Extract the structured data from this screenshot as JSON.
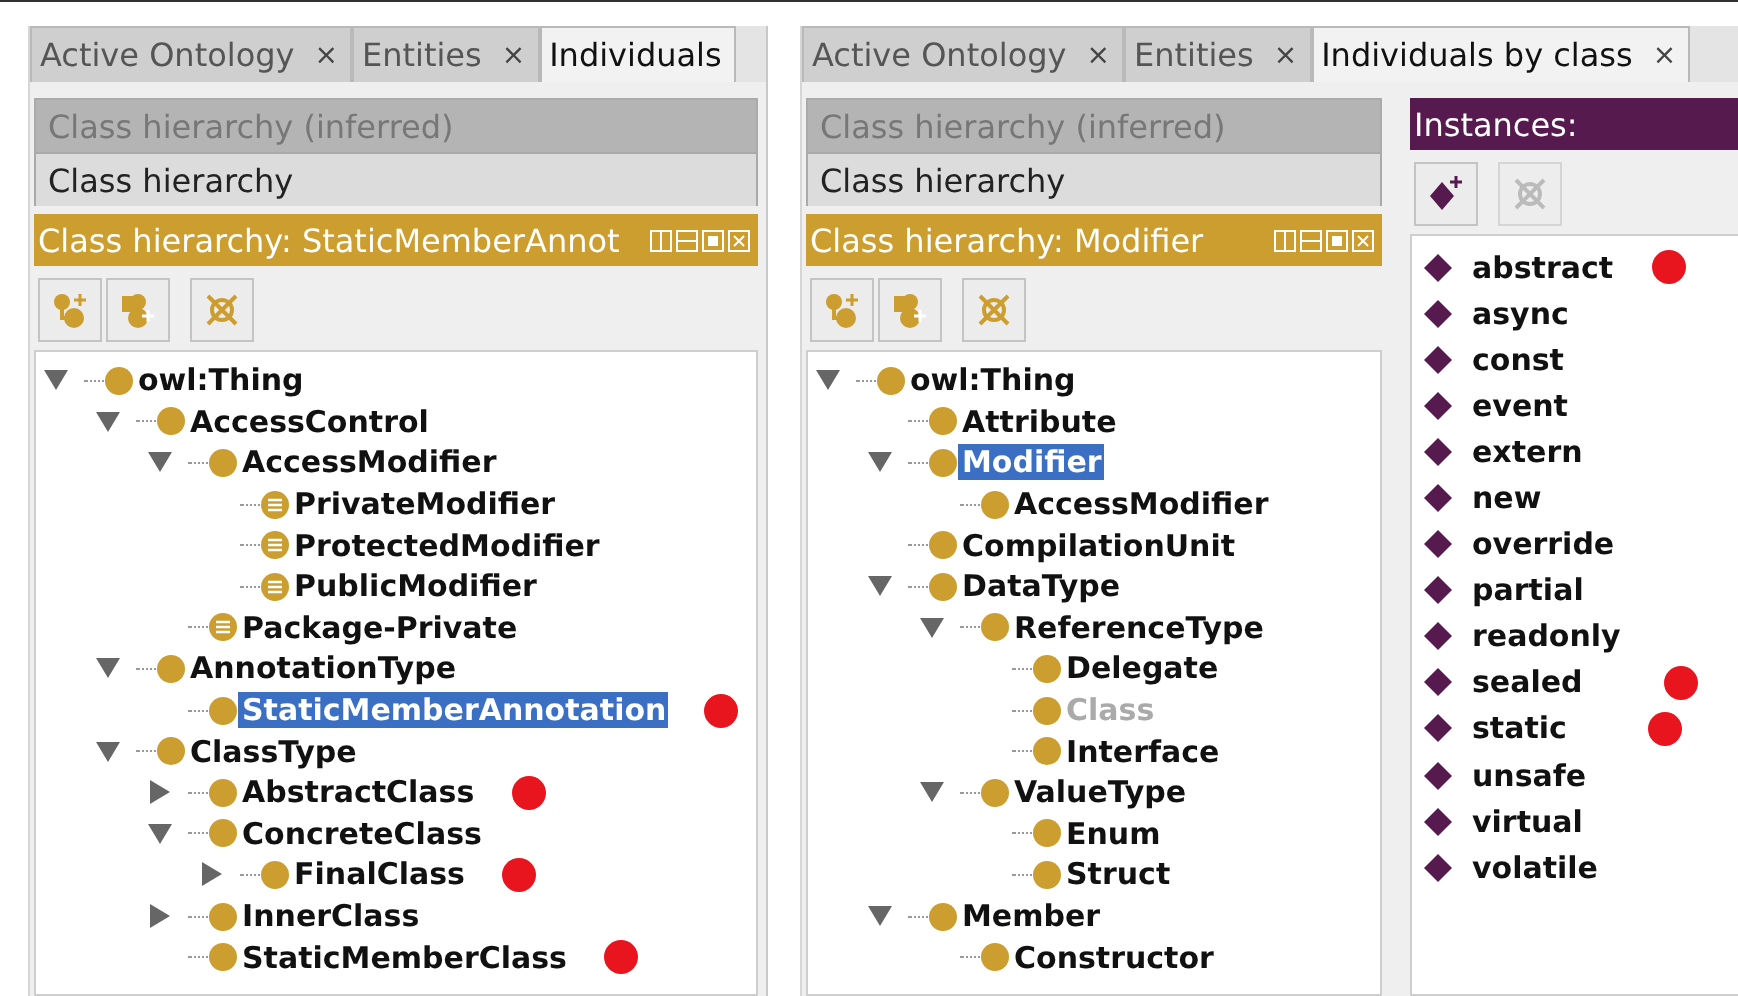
{
  "windows": [
    {
      "tabs": [
        {
          "label": "Active Ontology",
          "close": "×",
          "selected": false
        },
        {
          "label": "Entities",
          "close": "×",
          "selected": false
        },
        {
          "label": "Individuals",
          "selected": true
        }
      ],
      "views": [
        {
          "label": "Class hierarchy (inferred)",
          "selected": false
        },
        {
          "label": "Class hierarchy",
          "selected": true
        }
      ],
      "hierarchy_title": "Class hierarchy: StaticMemberAnnot",
      "tree": [
        {
          "label": "owl:Thing",
          "kind": "class",
          "expanded": true,
          "selected": false,
          "children": [
            {
              "label": "AccessControl",
              "kind": "class",
              "expanded": true,
              "selected": false,
              "children": [
                {
                  "label": "AccessModifier",
                  "kind": "class",
                  "expanded": true,
                  "selected": false,
                  "children": [
                    {
                      "label": "PrivateModifier",
                      "kind": "defined",
                      "selected": false
                    },
                    {
                      "label": "ProtectedModifier",
                      "kind": "defined",
                      "selected": false
                    },
                    {
                      "label": "PublicModifier",
                      "kind": "defined",
                      "selected": false
                    }
                  ]
                },
                {
                  "label": "Package-Private",
                  "kind": "defined",
                  "selected": false
                }
              ]
            },
            {
              "label": "AnnotationType",
              "kind": "class",
              "expanded": true,
              "selected": false,
              "children": [
                {
                  "label": "StaticMemberAnnotation",
                  "kind": "class",
                  "selected": true,
                  "marked": true
                }
              ]
            },
            {
              "label": "ClassType",
              "kind": "class",
              "expanded": true,
              "selected": false,
              "children": [
                {
                  "label": "AbstractClass",
                  "kind": "class",
                  "expanded": false,
                  "selected": false,
                  "marked": true
                },
                {
                  "label": "ConcreteClass",
                  "kind": "class",
                  "expanded": true,
                  "selected": false,
                  "children": [
                    {
                      "label": "FinalClass",
                      "kind": "class",
                      "expanded": false,
                      "selected": false,
                      "marked": true
                    }
                  ]
                },
                {
                  "label": "InnerClass",
                  "kind": "class",
                  "expanded": false,
                  "selected": false
                },
                {
                  "label": "StaticMemberClass",
                  "kind": "class",
                  "selected": false,
                  "marked": true
                }
              ]
            }
          ]
        }
      ]
    },
    {
      "tabs": [
        {
          "label": "Active Ontology",
          "close": "×",
          "selected": false
        },
        {
          "label": "Entities",
          "close": "×",
          "selected": false
        },
        {
          "label": "Individuals by class",
          "close": "×",
          "selected": true
        }
      ],
      "views": [
        {
          "label": "Class hierarchy (inferred)",
          "selected": false
        },
        {
          "label": "Class hierarchy",
          "selected": true
        }
      ],
      "hierarchy_title": "Class hierarchy: Modifier",
      "tree": [
        {
          "label": "owl:Thing",
          "kind": "class",
          "expanded": true,
          "selected": false,
          "children": [
            {
              "label": "Attribute",
              "kind": "class",
              "selected": false
            },
            {
              "label": "Modifier",
              "kind": "class",
              "expanded": true,
              "selected": true,
              "children": [
                {
                  "label": "AccessModifier",
                  "kind": "class",
                  "selected": false
                }
              ]
            },
            {
              "label": "CompilationUnit",
              "kind": "class",
              "selected": false
            },
            {
              "label": "DataType",
              "kind": "class",
              "expanded": true,
              "selected": false,
              "children": [
                {
                  "label": "ReferenceType",
                  "kind": "class",
                  "expanded": true,
                  "selected": false,
                  "children": [
                    {
                      "label": "Delegate",
                      "kind": "class",
                      "selected": false
                    },
                    {
                      "label": "Class",
                      "kind": "class",
                      "disabled": true,
                      "selected": false
                    },
                    {
                      "label": "Interface",
                      "kind": "class",
                      "selected": false
                    }
                  ]
                },
                {
                  "label": "ValueType",
                  "kind": "class",
                  "expanded": true,
                  "selected": false,
                  "children": [
                    {
                      "label": "Enum",
                      "kind": "class",
                      "selected": false
                    },
                    {
                      "label": "Struct",
                      "kind": "class",
                      "selected": false
                    }
                  ]
                }
              ]
            },
            {
              "label": "Member",
              "kind": "class",
              "expanded": true,
              "selected": false,
              "children": [
                {
                  "label": "Constructor",
                  "kind": "class",
                  "selected": false
                }
              ]
            }
          ]
        }
      ],
      "instances": {
        "title": "Instances:",
        "items": [
          {
            "label": "abstract",
            "selected": false,
            "marked": true
          },
          {
            "label": "async",
            "selected": false
          },
          {
            "label": "const",
            "selected": false
          },
          {
            "label": "event",
            "selected": false
          },
          {
            "label": "extern",
            "selected": false
          },
          {
            "label": "new",
            "selected": false
          },
          {
            "label": "override",
            "selected": false
          },
          {
            "label": "partial",
            "selected": false
          },
          {
            "label": "readonly",
            "selected": false
          },
          {
            "label": "sealed",
            "selected": false,
            "marked": true
          },
          {
            "label": "static",
            "selected": false,
            "marked": true
          },
          {
            "label": "unsafe",
            "selected": false
          },
          {
            "label": "virtual",
            "selected": false
          },
          {
            "label": "volatile",
            "selected": false
          }
        ]
      }
    }
  ]
}
